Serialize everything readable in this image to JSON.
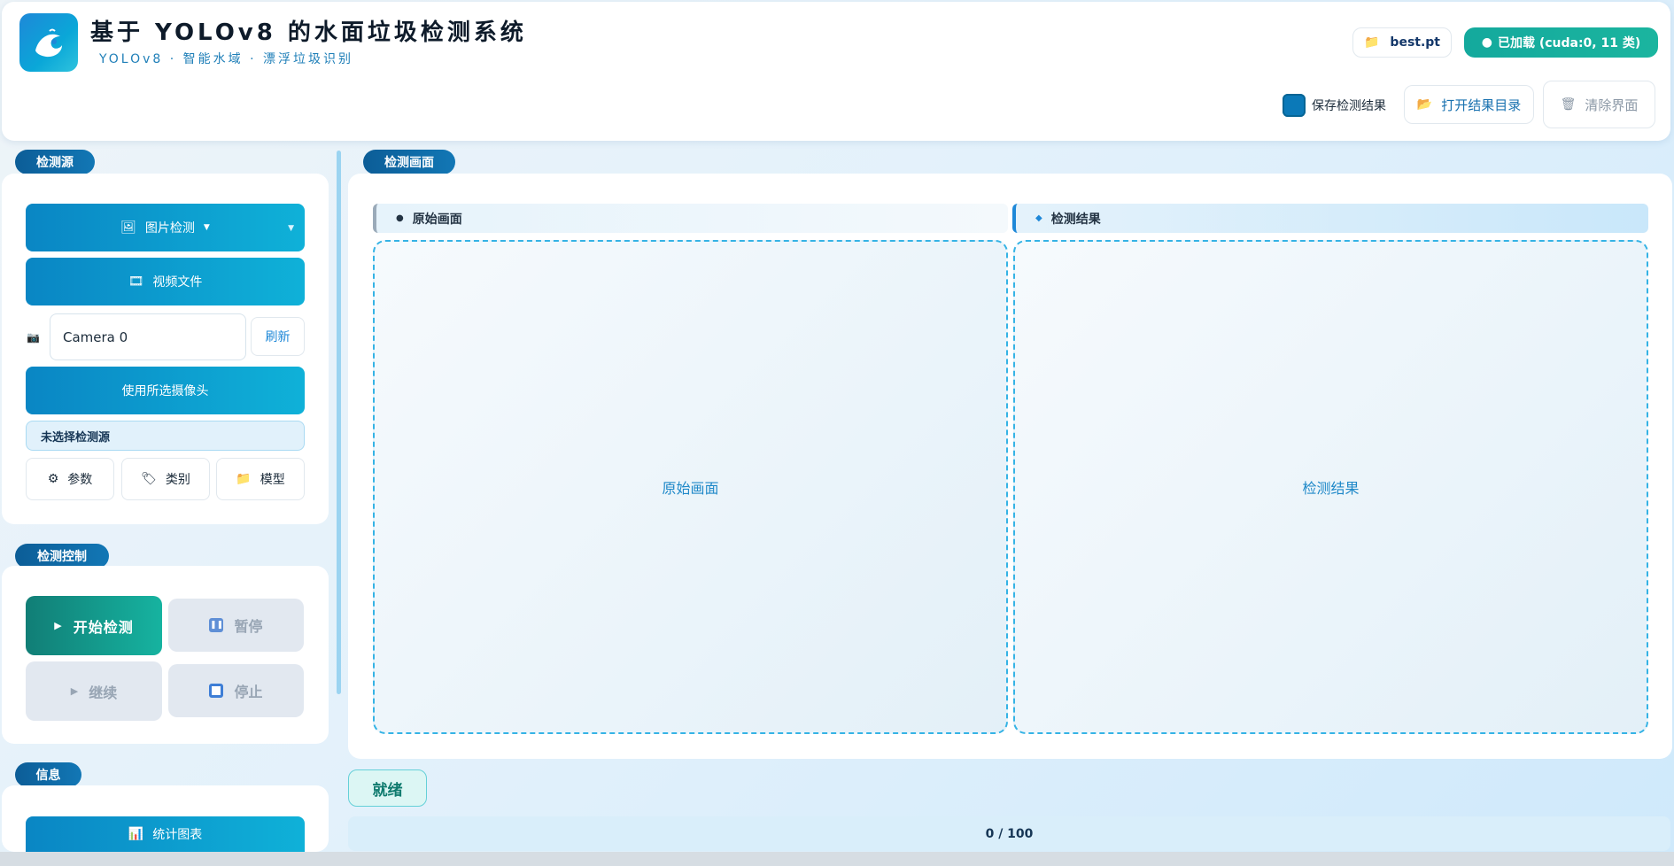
{
  "header": {
    "title": "基于 YOLOv8 的水面垃圾检测系统",
    "subtitle": "YOLOv8 · 智能水域 · 漂浮垃圾识别",
    "model_file": "best.pt",
    "model_status": "已加载 (cuda:0, 11 类)",
    "save_results_label": "保存检测结果",
    "open_results_label": "打开结果目录",
    "clear_label": "清除界面"
  },
  "source": {
    "section_title": "检测源",
    "image_mode": "图片检测",
    "video_label": "视频文件",
    "camera_value": "Camera 0",
    "refresh_label": "刷新",
    "use_camera_label": "使用所选摄像头",
    "status_text": "未选择检测源",
    "params_label": "参数",
    "classes_label": "类别",
    "model_label": "模型"
  },
  "control": {
    "section_title": "检测控制",
    "start_label": "开始检测",
    "pause_label": "暂停",
    "resume_label": "继续",
    "stop_label": "停止"
  },
  "info": {
    "section_title": "信息",
    "stats_label": "统计图表"
  },
  "view": {
    "section_title": "检测画面",
    "original_title": "原始画面",
    "result_title": "检测结果",
    "original_placeholder": "原始画面",
    "result_placeholder": "检测结果"
  },
  "status": {
    "state": "就绪",
    "progress_text": "0 / 100",
    "progress_fraction": 0
  },
  "icons": {
    "logo": "water-wave-logo-icon",
    "model": "folder-icon",
    "image": "picture-icon",
    "video": "film-icon",
    "camera": "camera-icon",
    "params": "gear-icon",
    "classes": "tag-icon",
    "open_results": "folder-icon",
    "clear": "trash-icon",
    "start": "play-icon",
    "pause": "pause-icon",
    "resume": "play-icon",
    "stop": "stop-icon",
    "stats": "bar-chart-icon"
  },
  "colors": {
    "accent": "#1e88d8",
    "teal": "#16b3a0",
    "tag_blue": "#0c5d97"
  }
}
